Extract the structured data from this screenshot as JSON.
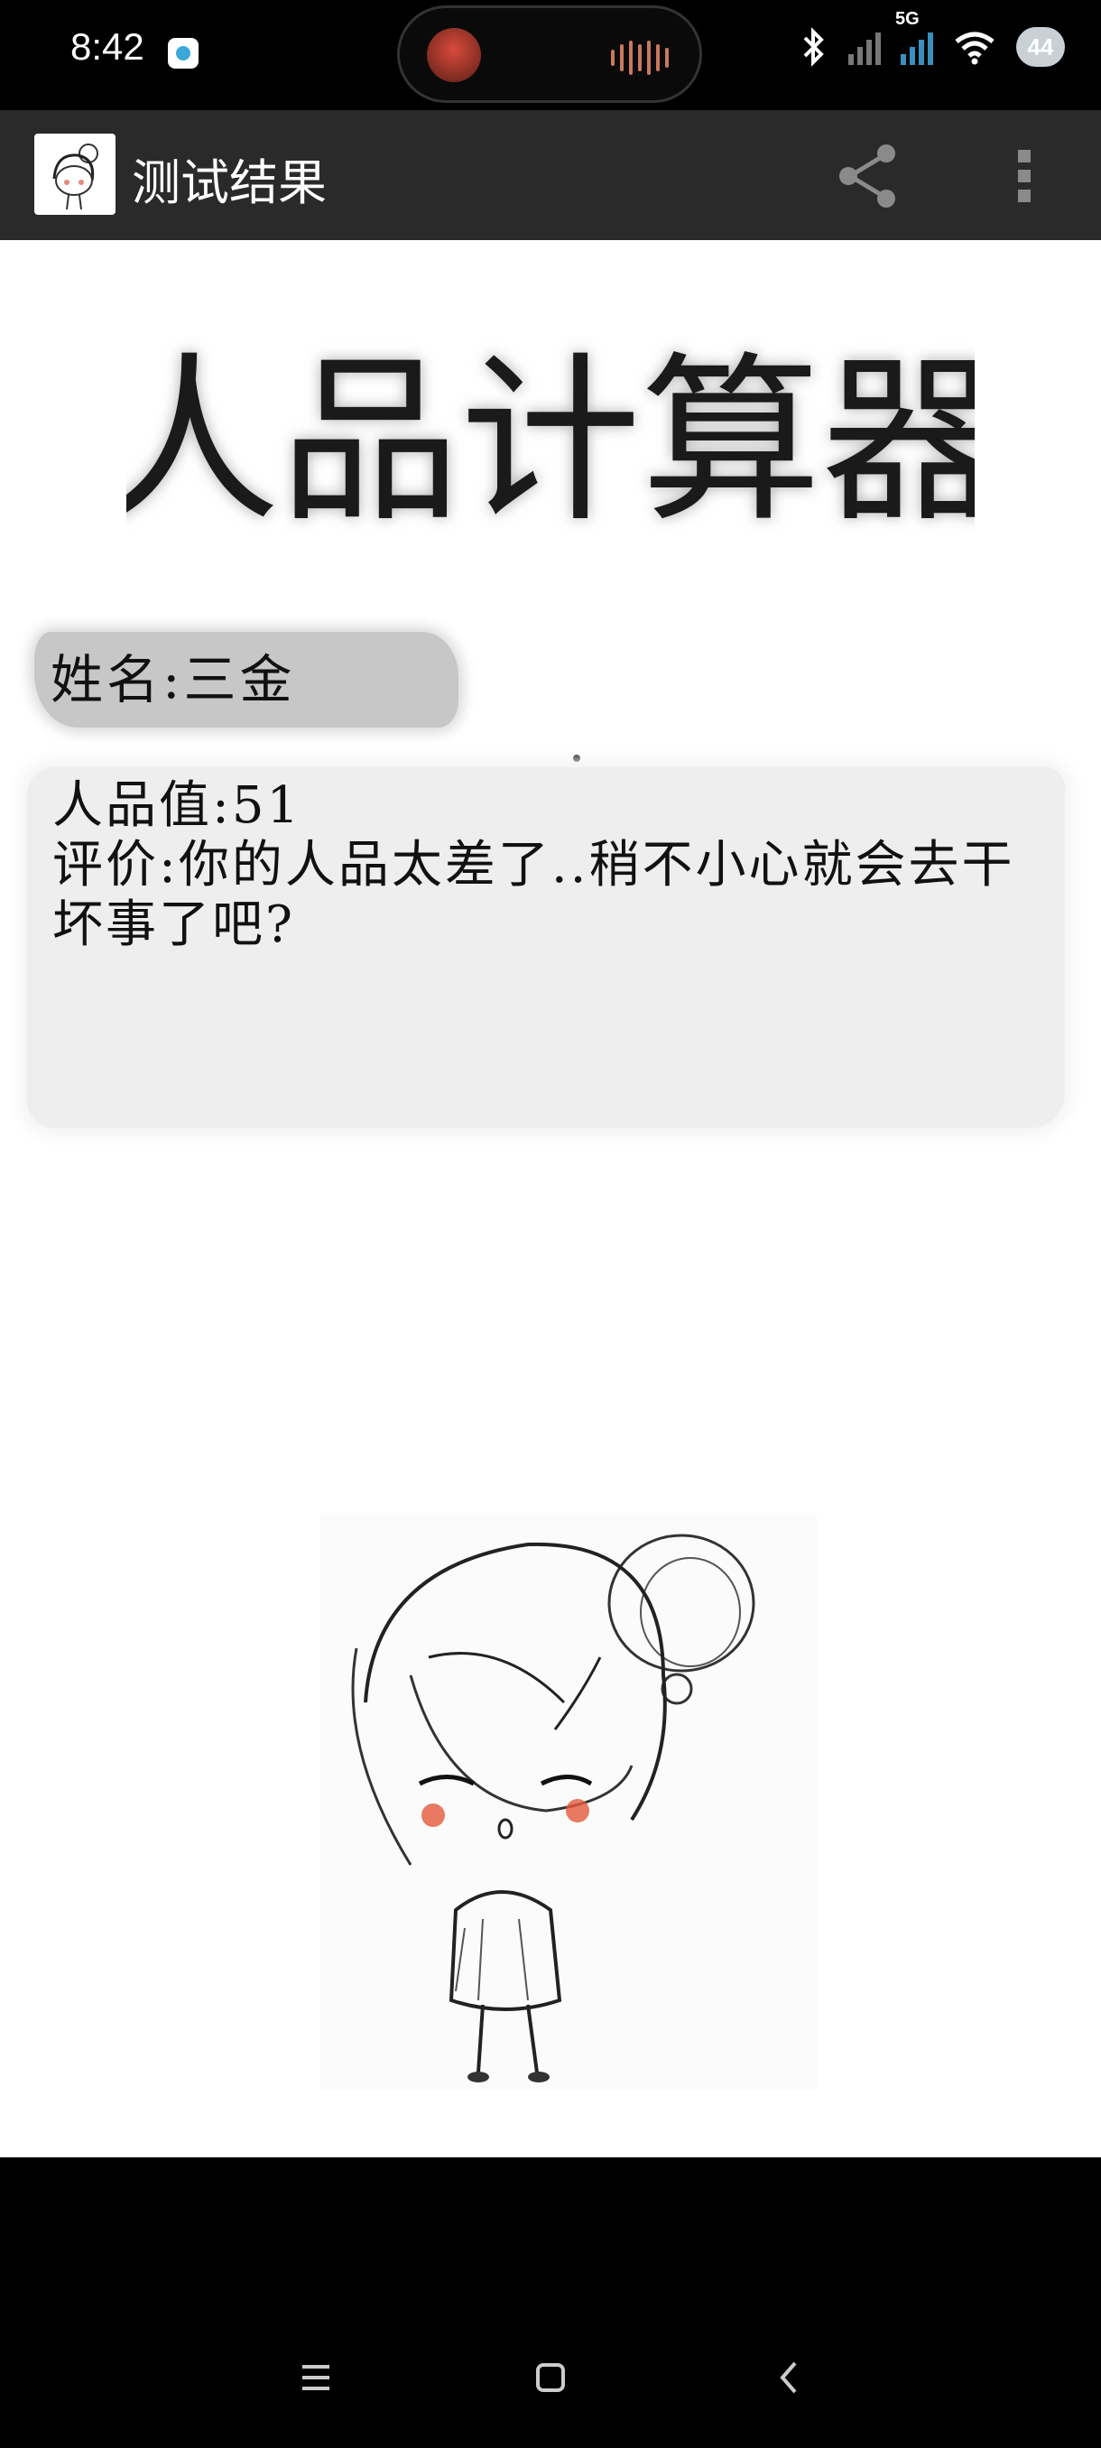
{
  "status_bar": {
    "time": "8:42",
    "network_label": "5G",
    "battery": "44",
    "icons": [
      "notification-app-icon",
      "bluetooth-icon",
      "signal-off-icon",
      "signal-5g-icon",
      "wifi-icon",
      "battery-icon"
    ]
  },
  "island": {
    "album_art": "media-art-icon",
    "waveform": "audio-wave-icon"
  },
  "action_bar": {
    "title": "测试结果",
    "app_icon": "app-logo-icon",
    "share_icon": "share-icon",
    "menu_icon": "more-vert-icon",
    "background": "#2a2a2a"
  },
  "content": {
    "hero_title": "人品计算器",
    "name_line": "姓名:三金",
    "score_line": "人品值:51",
    "comment_line": "评价:你的人品太差了..稍不小心就会去干坏事了吧?",
    "illustration": "girl-sketch-illustration"
  },
  "nav_bar": {
    "buttons": [
      "menu-icon",
      "home-icon",
      "back-icon"
    ]
  }
}
